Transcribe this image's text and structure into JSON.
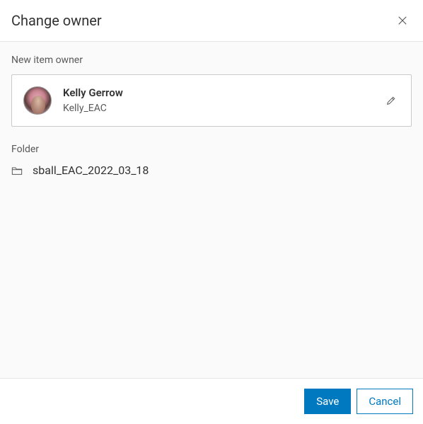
{
  "dialog": {
    "title": "Change owner"
  },
  "owner": {
    "field_label": "New item owner",
    "display_name": "Kelly Gerrow",
    "username": "Kelly_EAC"
  },
  "folder": {
    "field_label": "Folder",
    "name": "sball_EAC_2022_03_18"
  },
  "footer": {
    "save_label": "Save",
    "cancel_label": "Cancel"
  }
}
